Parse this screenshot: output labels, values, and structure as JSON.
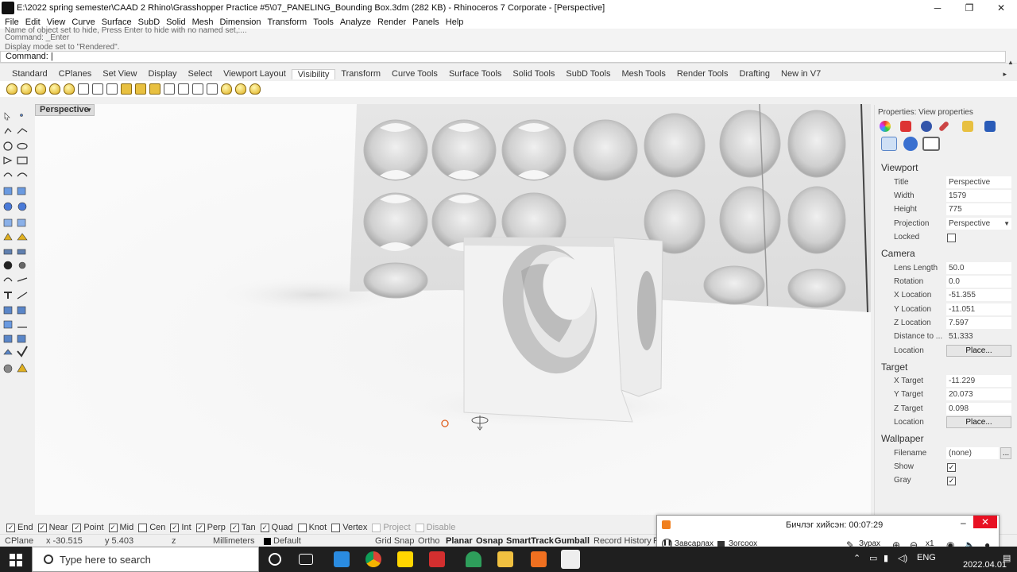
{
  "window": {
    "title": "E:\\2022 spring semester\\CAAD 2 Rhino\\Grasshopper Practice #5\\07_PANELING_Bounding Box.3dm (282 KB) - Rhinoceros 7 Corporate - [Perspective]",
    "minimize": "─",
    "maximize": "❐",
    "close": "✕"
  },
  "menu": [
    "File",
    "Edit",
    "View",
    "Curve",
    "Surface",
    "SubD",
    "Solid",
    "Mesh",
    "Dimension",
    "Transform",
    "Tools",
    "Analyze",
    "Render",
    "Panels",
    "Help"
  ],
  "command_history": [
    "Name of object set to hide, Press Enter to hide with no named set,:...",
    "Command: _Enter",
    "Display mode set to \"Rendered\"."
  ],
  "command_prompt": "Command:",
  "toolbar_tabs": [
    "Standard",
    "CPlanes",
    "Set View",
    "Display",
    "Select",
    "Viewport Layout",
    "Visibility",
    "Transform",
    "Curve Tools",
    "Surface Tools",
    "Solid Tools",
    "SubD Tools",
    "Mesh Tools",
    "Render Tools",
    "Drafting",
    "New in V7"
  ],
  "active_tab": "Visibility",
  "viewport_label": "Perspective",
  "properties": {
    "panel_title": "Properties: View properties",
    "viewport": {
      "section": "Viewport",
      "title_label": "Title",
      "title": "Perspective",
      "width_label": "Width",
      "width": "1579",
      "height_label": "Height",
      "height": "775",
      "projection_label": "Projection",
      "projection": "Perspective",
      "locked_label": "Locked",
      "locked": false
    },
    "camera": {
      "section": "Camera",
      "lens_label": "Lens Length",
      "lens": "50.0",
      "rotation_label": "Rotation",
      "rotation": "0.0",
      "x_label": "X Location",
      "x": "-51.355",
      "y_label": "Y Location",
      "y": "-11.051",
      "z_label": "Z Location",
      "z": "7.597",
      "dist_label": "Distance to ...",
      "dist": "51.333",
      "loc_label": "Location",
      "place": "Place..."
    },
    "target": {
      "section": "Target",
      "x_label": "X Target",
      "x": "-11.229",
      "y_label": "Y Target",
      "y": "20.073",
      "z_label": "Z Target",
      "z": "0.098",
      "loc_label": "Location",
      "place": "Place..."
    },
    "wallpaper": {
      "section": "Wallpaper",
      "filename_label": "Filename",
      "filename": "(none)",
      "browse": "...",
      "show_label": "Show",
      "gray_label": "Gray"
    }
  },
  "osnaps": [
    {
      "label": "End",
      "on": true
    },
    {
      "label": "Near",
      "on": true
    },
    {
      "label": "Point",
      "on": true
    },
    {
      "label": "Mid",
      "on": true
    },
    {
      "label": "Cen",
      "on": false
    },
    {
      "label": "Int",
      "on": true
    },
    {
      "label": "Perp",
      "on": true
    },
    {
      "label": "Tan",
      "on": true
    },
    {
      "label": "Quad",
      "on": true
    },
    {
      "label": "Knot",
      "on": false
    },
    {
      "label": "Vertex",
      "on": false
    },
    {
      "label": "Project",
      "on": false,
      "disabled": true
    },
    {
      "label": "Disable",
      "on": false,
      "disabled": true
    }
  ],
  "status": {
    "cplane": "CPlane",
    "x": "x -30.515",
    "y": "y 5.403",
    "z": "z",
    "units": "Millimeters",
    "layer": "Default",
    "grid_snap": "Grid Snap",
    "ortho": "Ortho",
    "planar": "Planar",
    "osnap": "Osnap",
    "smarttrack": "SmartTrack",
    "gumball": "Gumball",
    "record_history": "Record History",
    "filter": "F"
  },
  "recorder": {
    "title": "Бичлэг хийсэн: 00:07:29",
    "pause": "Завсарлах",
    "stop": "Зогсоох",
    "pen": "Зурах",
    "zoom": "x1"
  },
  "taskbar": {
    "search_placeholder": "Type here to search",
    "language": "ENG",
    "date": "2022.04.01"
  },
  "colors": {
    "accent": "#e81123",
    "recorder": "#f08020"
  }
}
